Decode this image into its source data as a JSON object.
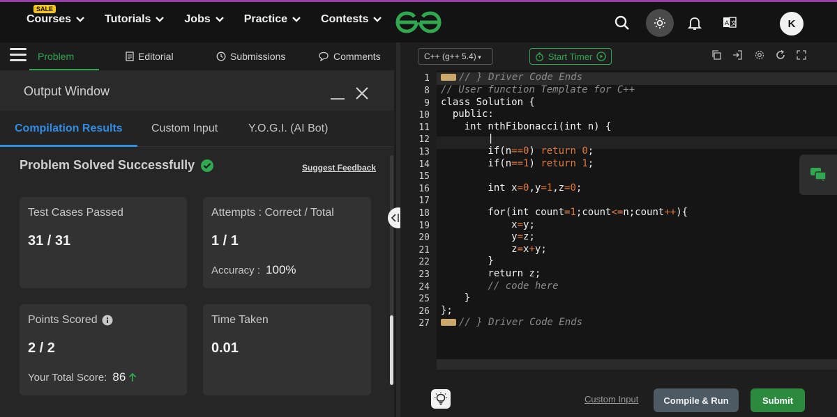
{
  "nav": {
    "sale_badge": "SALE",
    "items": [
      {
        "label": "Courses"
      },
      {
        "label": "Tutorials"
      },
      {
        "label": "Jobs"
      },
      {
        "label": "Practice"
      },
      {
        "label": "Contests"
      }
    ],
    "avatar": "K"
  },
  "tabs": {
    "problem": "Problem",
    "editorial": "Editorial",
    "submissions": "Submissions",
    "comments": "Comments"
  },
  "output": {
    "title": "Output Window",
    "tabs": [
      "Compilation Results",
      "Custom Input",
      "Y.O.G.I. (AI Bot)"
    ],
    "status": "Problem Solved Successfully",
    "feedback": "Suggest Feedback",
    "cards": {
      "tests_label": "Test Cases Passed",
      "tests_value": "31 / 31",
      "attempts_label": "Attempts : Correct / Total",
      "attempts_value": "1 / 1",
      "accuracy_label": "Accuracy :",
      "accuracy_value": "100%",
      "points_label": "Points Scored",
      "points_value": "2 / 2",
      "total_label": "Your Total Score:",
      "total_value": "86",
      "time_label": "Time Taken",
      "time_value": "0.01"
    }
  },
  "editor": {
    "language": "C++ (g++ 5.4)",
    "timer": "Start Timer",
    "line_numbers": [
      "1",
      "8",
      "9",
      "10",
      "11",
      "12",
      "13",
      "14",
      "15",
      "16",
      "17",
      "18",
      "19",
      "20",
      "21",
      "22",
      "23",
      "24",
      "25",
      "26",
      "27"
    ],
    "custom_input": "Custom Input",
    "compile_run": "Compile & Run",
    "submit": "Submit"
  },
  "colors": {
    "accent_green": "#2fa84f",
    "accent_blue": "#2f8de4",
    "topbar_border": "#9a3fa8"
  }
}
